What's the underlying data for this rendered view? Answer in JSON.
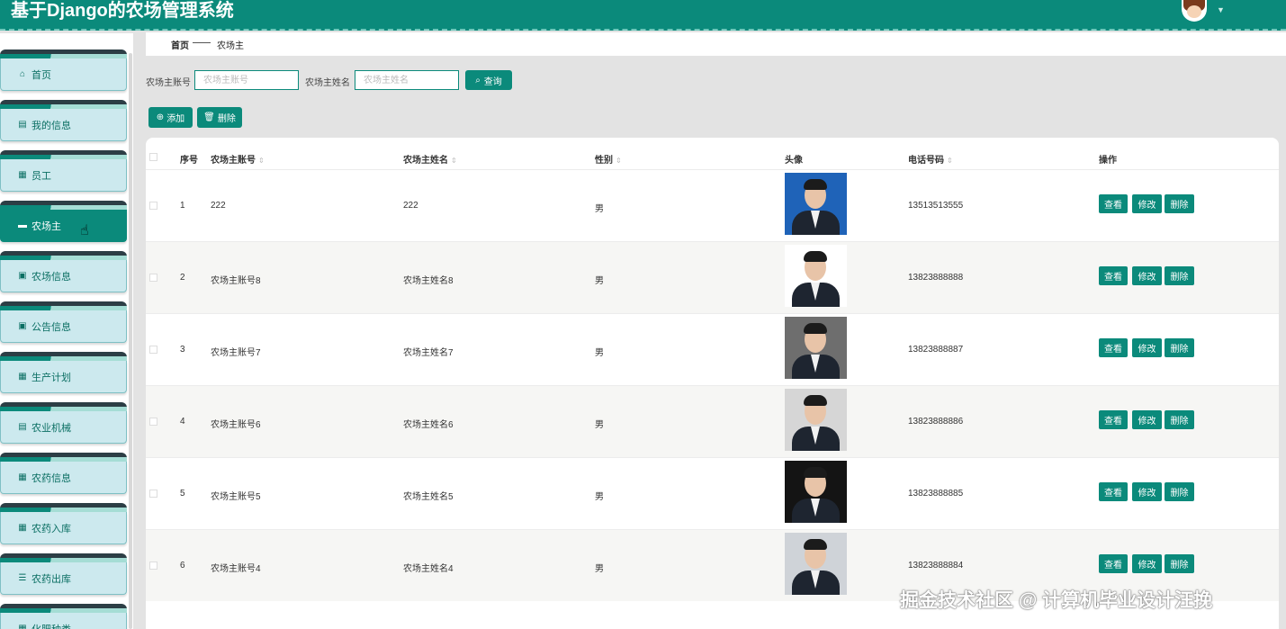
{
  "app": {
    "title": "基于Django的农场管理系统"
  },
  "sidebar": {
    "items": [
      {
        "label": "首页",
        "icon": "home-icon",
        "glyph": "⌂",
        "active": false
      },
      {
        "label": "我的信息",
        "icon": "id-card-icon",
        "glyph": "▤",
        "active": false
      },
      {
        "label": "员工",
        "icon": "grid-icon",
        "glyph": "▦",
        "active": false
      },
      {
        "label": "农场主",
        "icon": "monitor-icon",
        "glyph": "▬",
        "active": true
      },
      {
        "label": "农场信息",
        "icon": "clipboard-icon",
        "glyph": "▣",
        "active": false
      },
      {
        "label": "公告信息",
        "icon": "check-square-icon",
        "glyph": "▣",
        "active": false
      },
      {
        "label": "生产计划",
        "icon": "grid-icon",
        "glyph": "▦",
        "active": false
      },
      {
        "label": "农业机械",
        "icon": "document-icon",
        "glyph": "▤",
        "active": false
      },
      {
        "label": "农药信息",
        "icon": "grid-icon",
        "glyph": "▦",
        "active": false
      },
      {
        "label": "农药入库",
        "icon": "grid-icon",
        "glyph": "▦",
        "active": false
      },
      {
        "label": "农药出库",
        "icon": "sliders-icon",
        "glyph": "☰",
        "active": false
      },
      {
        "label": "化肥种类",
        "icon": "grid-icon",
        "glyph": "▦",
        "active": false
      }
    ]
  },
  "breadcrumb": {
    "home": "首页",
    "current": "农场主"
  },
  "search": {
    "account_label": "农场主账号",
    "account_placeholder": "农场主账号",
    "name_label": "农场主姓名",
    "name_placeholder": "农场主姓名",
    "query_button": "查询"
  },
  "toolbar": {
    "add_button": "添加",
    "delete_button": "删除"
  },
  "table": {
    "headers": {
      "index": "序号",
      "account": "农场主账号",
      "name": "农场主姓名",
      "gender": "性别",
      "avatar": "头像",
      "phone": "电话号码",
      "actions": "操作"
    },
    "action_labels": {
      "view": "查看",
      "edit": "修改",
      "delete": "删除"
    },
    "rows": [
      {
        "index": "1",
        "account": "222",
        "name": "222",
        "gender": "男",
        "phone": "13513513555",
        "photo_bg": "#1f63b8"
      },
      {
        "index": "2",
        "account": "农场主账号8",
        "name": "农场主姓名8",
        "gender": "男",
        "phone": "13823888888",
        "photo_bg": "#ffffff"
      },
      {
        "index": "3",
        "account": "农场主账号7",
        "name": "农场主姓名7",
        "gender": "男",
        "phone": "13823888887",
        "photo_bg": "#6e6e6e"
      },
      {
        "index": "4",
        "account": "农场主账号6",
        "name": "农场主姓名6",
        "gender": "男",
        "phone": "13823888886",
        "photo_bg": "#d6d6d6"
      },
      {
        "index": "5",
        "account": "农场主账号5",
        "name": "农场主姓名5",
        "gender": "男",
        "phone": "13823888885",
        "photo_bg": "#141414"
      },
      {
        "index": "6",
        "account": "农场主账号4",
        "name": "农场主姓名4",
        "gender": "男",
        "phone": "13823888884",
        "photo_bg": "#cfd3d8"
      }
    ]
  },
  "watermark": "掘金技术社区 @ 计算机毕业设计汪挽"
}
